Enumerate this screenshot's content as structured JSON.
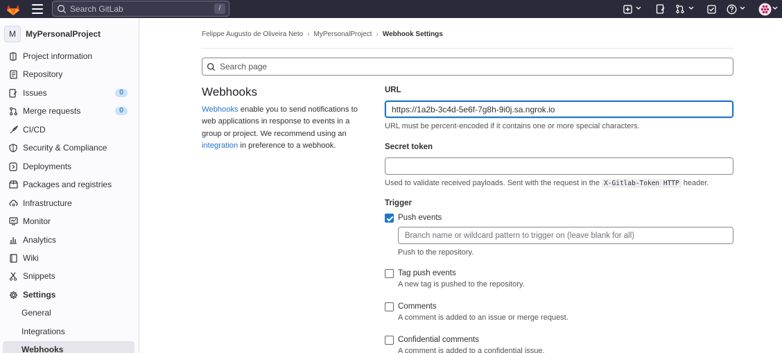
{
  "topbar": {
    "search_placeholder": "Search GitLab",
    "search_shortcut": "/",
    "icons": [
      "gitlab-logo",
      "hamburger-menu",
      "plus-icon",
      "issues-icon",
      "merge-request-icon",
      "todo-icon",
      "help-icon",
      "avatar"
    ]
  },
  "sidebar": {
    "project_initial": "M",
    "project_name": "MyPersonalProject",
    "items": [
      {
        "label": "Project information",
        "icon": "info-icon"
      },
      {
        "label": "Repository",
        "icon": "document-icon"
      },
      {
        "label": "Issues",
        "icon": "issues-icon",
        "badge": "0"
      },
      {
        "label": "Merge requests",
        "icon": "merge-request-icon",
        "badge": "0"
      },
      {
        "label": "CI/CD",
        "icon": "rocket-icon"
      },
      {
        "label": "Security & Compliance",
        "icon": "shield-icon"
      },
      {
        "label": "Deployments",
        "icon": "deployments-icon"
      },
      {
        "label": "Packages and registries",
        "icon": "package-icon"
      },
      {
        "label": "Infrastructure",
        "icon": "cloud-gear-icon"
      },
      {
        "label": "Monitor",
        "icon": "monitor-icon"
      },
      {
        "label": "Analytics",
        "icon": "chart-icon"
      },
      {
        "label": "Wiki",
        "icon": "book-icon"
      },
      {
        "label": "Snippets",
        "icon": "snippet-icon"
      },
      {
        "label": "Settings",
        "icon": "gear-icon"
      }
    ],
    "settings_sub": [
      {
        "label": "General"
      },
      {
        "label": "Integrations"
      },
      {
        "label": "Webhooks",
        "active": true
      }
    ]
  },
  "breadcrumb": {
    "items": [
      "Felippe Augusto de Oliveira Neto",
      "MyPersonalProject",
      "Webhook Settings"
    ]
  },
  "page_search": {
    "placeholder": "Search page"
  },
  "webhooks": {
    "title": "Webhooks",
    "desc_link1": "Webhooks",
    "desc_part1": " enable you to send notifications to web applications in response to events in a group or project. We recommend using an ",
    "desc_link2": "integration",
    "desc_part2": " in preference to a webhook."
  },
  "form": {
    "url_label": "URL",
    "url_value": "https://1a2b-3c4d-5e6f-7g8h-9i0j.sa.ngrok.io",
    "url_help": "URL must be percent-encoded if it contains one or more special characters.",
    "secret_label": "Secret token",
    "secret_value": "",
    "secret_help_pre": "Used to validate received payloads. Sent with the request in the ",
    "secret_help_code": "X-Gitlab-Token HTTP",
    "secret_help_post": " header.",
    "trigger_label": "Trigger",
    "triggers": [
      {
        "label": "Push events",
        "checked": true,
        "help": "Push to the repository."
      },
      {
        "label": "Tag push events",
        "checked": false,
        "help": "A new tag is pushed to the repository."
      },
      {
        "label": "Comments",
        "checked": false,
        "help": "A comment is added to an issue or merge request."
      },
      {
        "label": "Confidential comments",
        "checked": false,
        "help": "A comment is added to a confidential issue."
      }
    ],
    "branch_placeholder": "Branch name or wildcard pattern to trigger on (leave blank for all)"
  },
  "colors": {
    "topbar": "#2b2a3b",
    "accent": "#1f75cb",
    "badge_bg": "#cbe2f9",
    "sidebar_bg": "#fbfafd"
  }
}
